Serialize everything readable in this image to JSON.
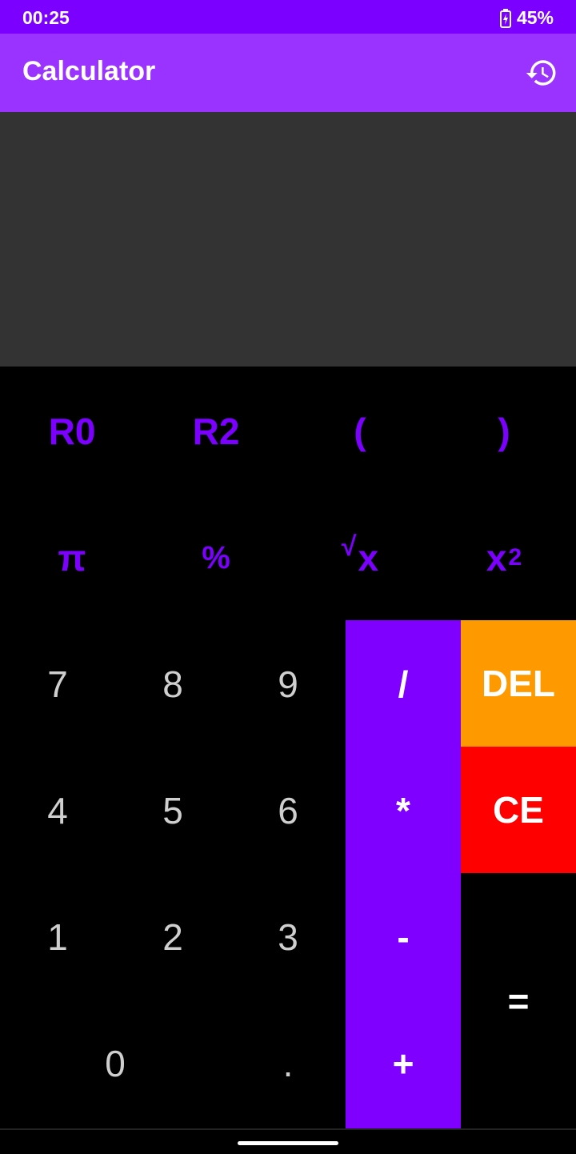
{
  "status": {
    "time": "00:25",
    "battery": "45%"
  },
  "appbar": {
    "title": "Calculator"
  },
  "keys": {
    "row1": [
      "R0",
      "R2",
      "(",
      ")"
    ],
    "pi": "π",
    "percent": "%",
    "sqrt_base": "x",
    "sqrt_prefix": "√",
    "square_base": "x",
    "square_sup": "2",
    "n7": "7",
    "n8": "8",
    "n9": "9",
    "n4": "4",
    "n5": "5",
    "n6": "6",
    "n1": "1",
    "n2": "2",
    "n3": "3",
    "n0": "0",
    "dot": ".",
    "div": "/",
    "mul": "*",
    "minus": "-",
    "plus": "+",
    "del": "DEL",
    "ce": "CE",
    "eq": "="
  },
  "colors": {
    "accent": "#7b00ff",
    "appbar": "#9a33ff",
    "display": "#333333",
    "del": "#ff9900",
    "ce": "#ff0000",
    "op": "#7f00ff"
  }
}
